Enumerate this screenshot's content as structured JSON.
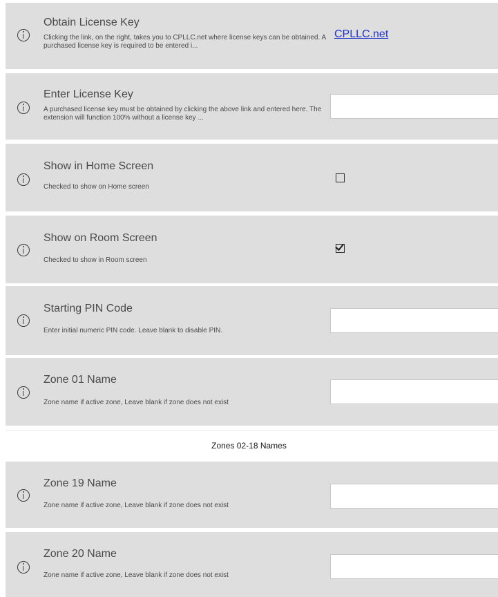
{
  "settings": [
    {
      "title": "Obtain License Key",
      "description": "Clicking the link, on the right, takes you to CPLLC.net where license keys can be obtained.  A purchased license key is required to be entered i...",
      "link_text": "CPLLC.net"
    },
    {
      "title": "Enter License Key",
      "description": "A purchased license key must be obtained by clicking the above link and entered here. The extension will function 100% without a license key ...",
      "input_value": ""
    },
    {
      "title": "Show in Home Screen",
      "description": "Checked to show on Home screen",
      "checked": false
    },
    {
      "title": "Show on Room Screen",
      "description": "Checked to show in Room screen",
      "checked": true
    },
    {
      "title": "Starting PIN Code",
      "description": "Enter initial numeric PIN code.  Leave blank to disable PIN.",
      "input_value": ""
    },
    {
      "title": "Zone 01 Name",
      "description": "Zone name if active zone,  Leave blank if zone does not exist",
      "input_value": ""
    },
    {
      "title": "Zone 19 Name",
      "description": "Zone name if active zone,  Leave blank if zone does not exist",
      "input_value": ""
    },
    {
      "title": "Zone 20 Name",
      "description": "Zone name if active zone,  Leave blank if zone does not exist",
      "input_value": ""
    }
  ],
  "group_label": "Zones 02-18 Names",
  "colors": {
    "row_background": "#dedede",
    "link": "#1e33cc",
    "text": "#4a4a4a"
  }
}
